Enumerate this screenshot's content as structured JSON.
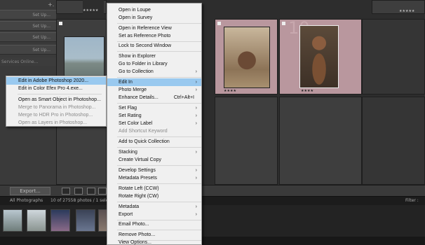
{
  "left_panel": {
    "rows": [
      "Set Up...",
      "Set Up...",
      "Set Up...",
      "Set Up..."
    ],
    "services_label": "Services Online...",
    "plus_label": "+."
  },
  "grid": {
    "cells": [
      {
        "number": "",
        "stars": "",
        "selected": false
      },
      {
        "number": "",
        "stars": "★★★★★",
        "selected": false
      },
      {
        "number": "",
        "stars": "★★★★",
        "selected": true
      },
      {
        "number": "10",
        "stars": "★★★★",
        "selected": true
      },
      {
        "number": "",
        "stars": "★★★★★",
        "selected": false
      }
    ]
  },
  "toolbar": {
    "export_label": "Export..."
  },
  "film_header": {
    "source": "All Photographs",
    "count": "10 of 27558 photos / 1 selected",
    "filter_label": "Filter :"
  },
  "context_menu": {
    "items": [
      {
        "label": "Open in Loupe"
      },
      {
        "label": "Open in Survey"
      },
      {
        "label": "Open in Reference View"
      },
      {
        "label": "Set as Reference Photo"
      },
      {
        "label": "Lock to Second Window"
      },
      {
        "label": "Show in Explorer"
      },
      {
        "label": "Go to Folder in Library"
      },
      {
        "label": "Go to Collection",
        "arrow": "›"
      },
      {
        "label": "Edit In",
        "arrow": "›"
      },
      {
        "label": "Photo Merge",
        "arrow": "›"
      },
      {
        "label": "Enhance Details...",
        "shortcut": "Ctrl+Alt+I"
      },
      {
        "label": "Set Flag",
        "arrow": "›"
      },
      {
        "label": "Set Rating",
        "arrow": "›"
      },
      {
        "label": "Set Color Label",
        "arrow": "›"
      },
      {
        "label": "Add Shortcut Keyword"
      },
      {
        "label": "Add to Quick Collection"
      },
      {
        "label": "Stacking",
        "arrow": "›"
      },
      {
        "label": "Create Virtual Copy"
      },
      {
        "label": "Develop Settings",
        "arrow": "›"
      },
      {
        "label": "Metadata Presets",
        "arrow": "›"
      },
      {
        "label": "Rotate Left (CCW)"
      },
      {
        "label": "Rotate Right (CW)"
      },
      {
        "label": "Metadata",
        "arrow": "›"
      },
      {
        "label": "Export",
        "arrow": "›"
      },
      {
        "label": "Email Photo..."
      },
      {
        "label": "Remove Photo..."
      },
      {
        "label": "View Options..."
      }
    ]
  },
  "submenu": {
    "items": [
      {
        "label": "Edit in Adobe Photoshop 2020..."
      },
      {
        "label": "Edit in Color Efex Pro 4.exe..."
      },
      {
        "label": "Open as Smart Object in Photoshop..."
      },
      {
        "label": "Merge to Panorama in Photoshop..."
      },
      {
        "label": "Merge to HDR Pro in Photoshop..."
      },
      {
        "label": "Open as Layers in Photoshop..."
      }
    ]
  },
  "colors": {
    "menu_bg": "#f0f0f0",
    "highlight": "#99c9ef",
    "selected_cell": "#b9979e",
    "panel_bg": "#3a3a3a"
  }
}
